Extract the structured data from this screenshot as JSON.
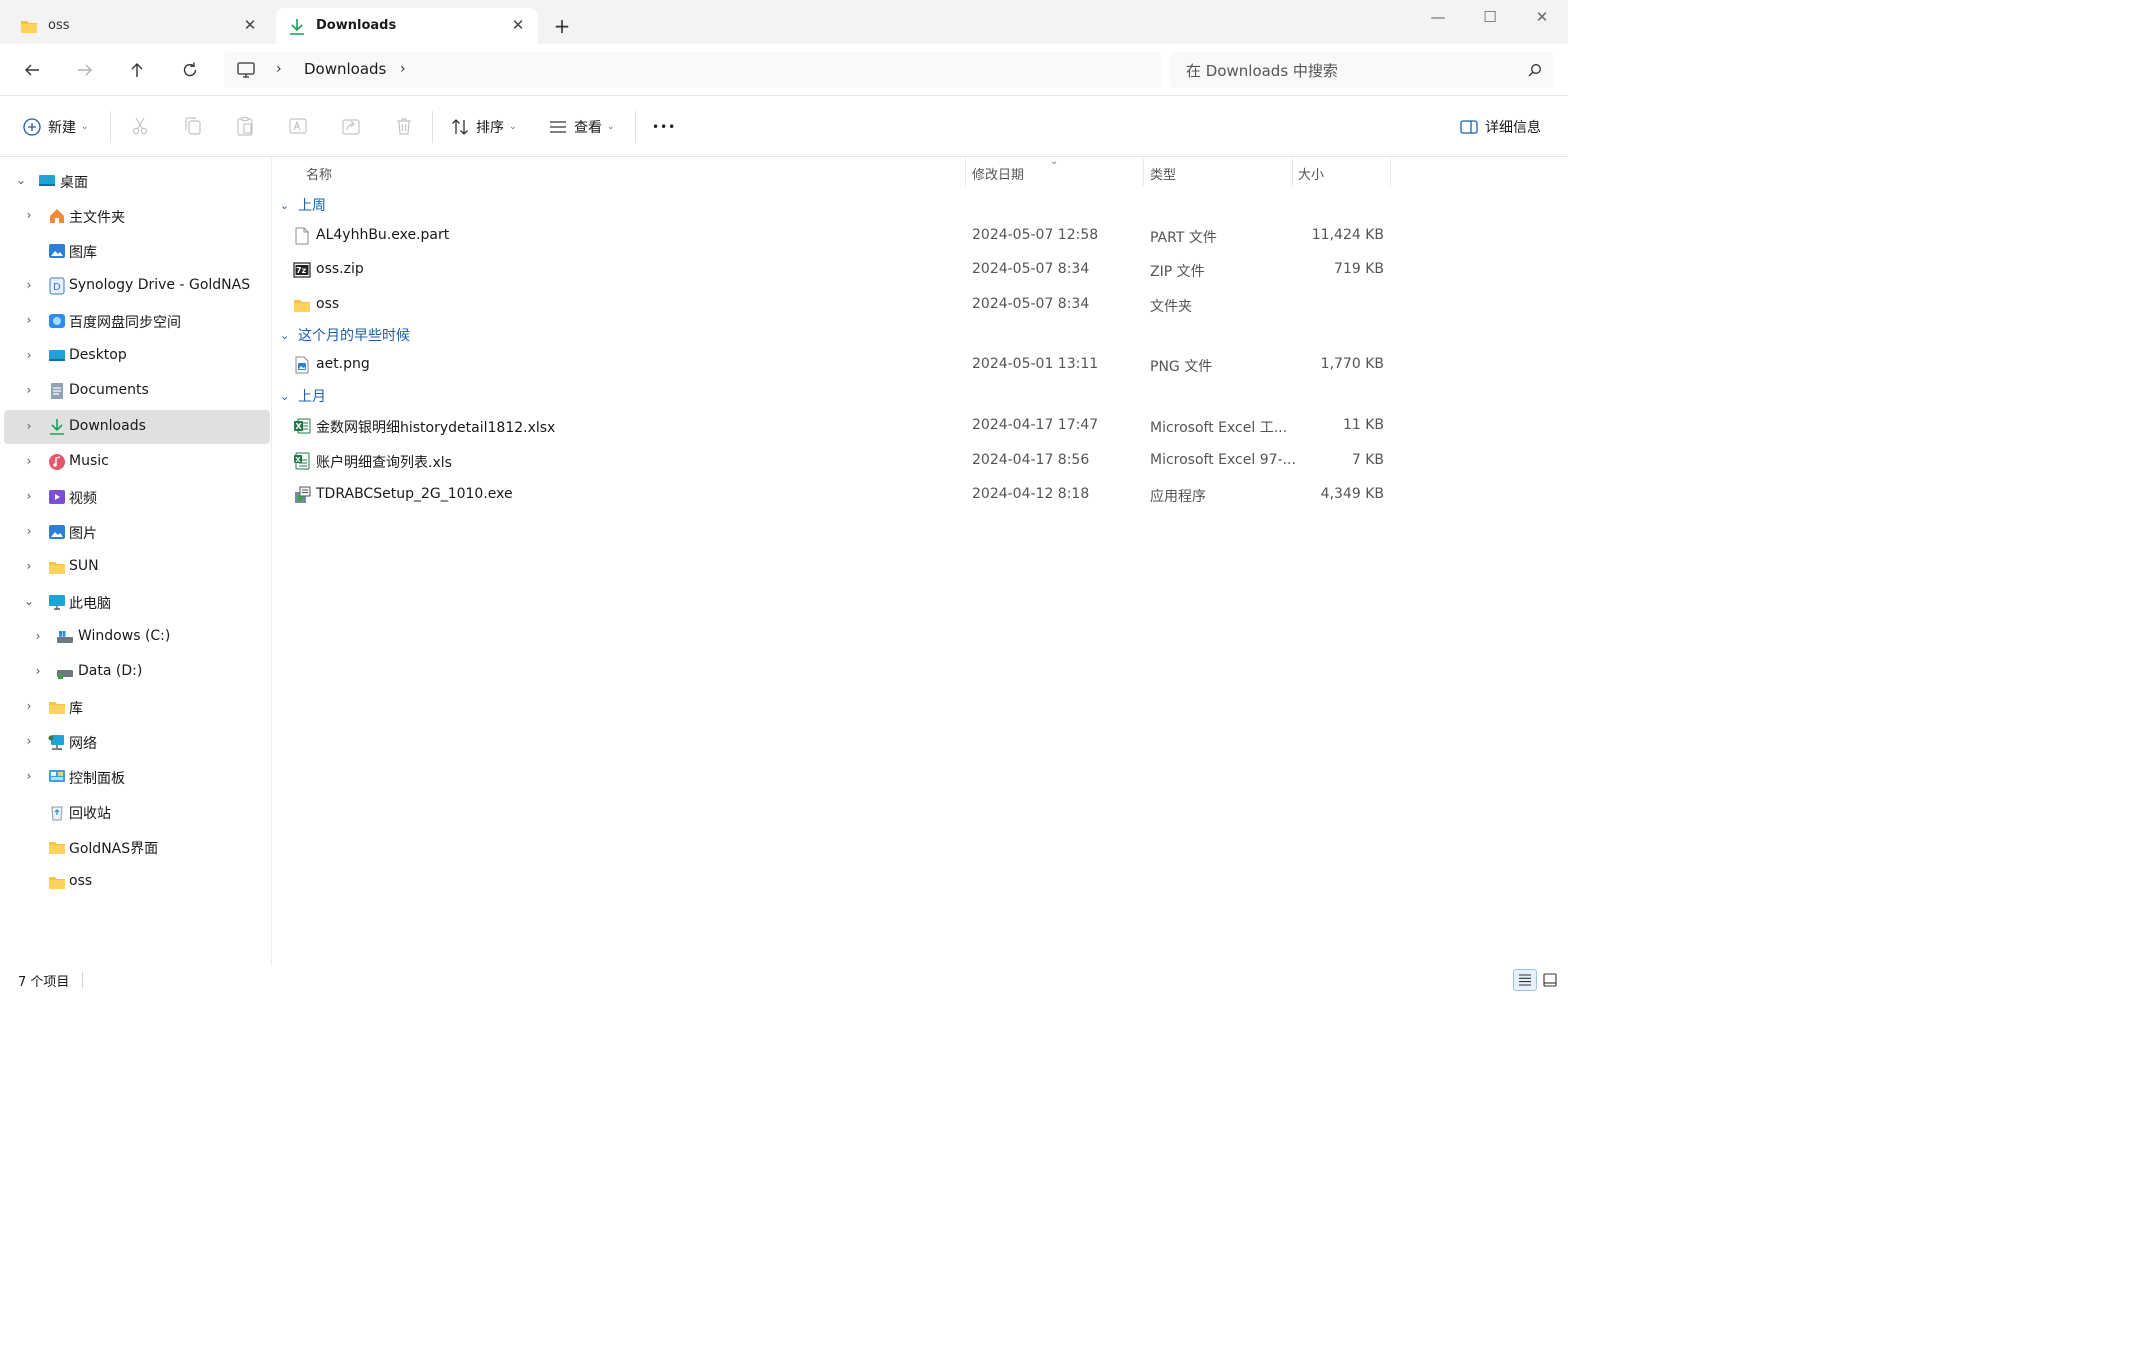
{
  "window": {
    "tabs": [
      {
        "label": "oss",
        "close": "✕"
      },
      {
        "label": "Downloads",
        "close": "✕"
      }
    ],
    "new_tab": "+",
    "controls": {
      "minimize": "—",
      "maximize": "☐",
      "close": "✕"
    }
  },
  "nav": {
    "breadcrumb": [
      "Downloads"
    ],
    "crumb_separator": "›",
    "search_placeholder": "在 Downloads 中搜索"
  },
  "toolbar": {
    "new_label": "新建",
    "sort_label": "排序",
    "view_label": "查看",
    "more_label": "•••",
    "details_label": "详细信息"
  },
  "sidebar": {
    "items": [
      {
        "label": "桌面",
        "icon": "desktop-icon",
        "expanded": true
      },
      {
        "label": "主文件夹",
        "icon": "home-icon"
      },
      {
        "label": "图库",
        "icon": "gallery-icon"
      },
      {
        "label": "Synology Drive - GoldNAS",
        "icon": "synology-drive-icon"
      },
      {
        "label": "百度网盘同步空间",
        "icon": "baidu-netdisk-icon"
      },
      {
        "label": "Desktop",
        "icon": "desktop-folder-icon"
      },
      {
        "label": "Documents",
        "icon": "documents-icon"
      },
      {
        "label": "Downloads",
        "icon": "downloads-icon",
        "selected": true
      },
      {
        "label": "Music",
        "icon": "music-icon"
      },
      {
        "label": "视频",
        "icon": "videos-icon"
      },
      {
        "label": "图片",
        "icon": "pictures-icon"
      },
      {
        "label": "SUN",
        "icon": "folder-icon"
      },
      {
        "label": "此电脑",
        "icon": "this-pc-icon",
        "expanded": true
      },
      {
        "label": "Windows (C:)",
        "icon": "drive-c-icon"
      },
      {
        "label": "Data (D:)",
        "icon": "drive-d-icon"
      },
      {
        "label": "库",
        "icon": "libraries-icon"
      },
      {
        "label": "网络",
        "icon": "network-icon"
      },
      {
        "label": "控制面板",
        "icon": "control-panel-icon"
      },
      {
        "label": "回收站",
        "icon": "recycle-bin-icon"
      },
      {
        "label": "GoldNAS界面",
        "icon": "folder-icon"
      },
      {
        "label": "oss",
        "icon": "folder-icon"
      }
    ]
  },
  "filelist": {
    "columns": {
      "name": "名称",
      "date": "修改日期",
      "type": "类型",
      "size": "大小"
    },
    "sort_indicator": "⌄",
    "groups": [
      {
        "label": "上周",
        "files": [
          {
            "name": "AL4yhhBu.exe.part",
            "date": "2024-05-07 12:58",
            "type": "PART 文件",
            "size": "11,424 KB",
            "icon": "blank-file-icon"
          },
          {
            "name": "oss.zip",
            "date": "2024-05-07 8:34",
            "type": "ZIP 文件",
            "size": "719 KB",
            "icon": "7zip-archive-icon"
          },
          {
            "name": "oss",
            "date": "2024-05-07 8:34",
            "type": "文件夹",
            "size": "",
            "icon": "folder-icon"
          }
        ]
      },
      {
        "label": "这个月的早些时候",
        "files": [
          {
            "name": "aet.png",
            "date": "2024-05-01 13:11",
            "type": "PNG 文件",
            "size": "1,770 KB",
            "icon": "image-file-icon"
          }
        ]
      },
      {
        "label": "上月",
        "files": [
          {
            "name": "金数网银明细historydetail1812.xlsx",
            "date": "2024-04-17 17:47",
            "type": "Microsoft Excel 工...",
            "size": "11 KB",
            "icon": "excel-icon"
          },
          {
            "name": "账户明细查询列表.xls",
            "date": "2024-04-17 8:56",
            "type": "Microsoft Excel 97-...",
            "size": "7 KB",
            "icon": "excel-97-icon"
          },
          {
            "name": "TDRABCSetup_2G_1010.exe",
            "date": "2024-04-12 8:18",
            "type": "应用程序",
            "size": "4,349 KB",
            "icon": "installer-icon"
          }
        ]
      }
    ]
  },
  "status": {
    "item_count": "7 个项目"
  }
}
